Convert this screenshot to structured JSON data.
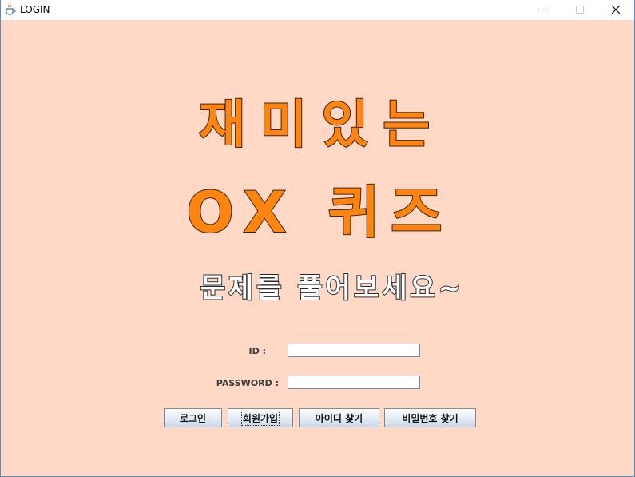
{
  "window": {
    "title": "LOGIN",
    "icons": {
      "app": "java-coffee-cup-icon",
      "minimize": "minimize-icon",
      "maximize": "maximize-icon",
      "close": "close-icon"
    }
  },
  "colors": {
    "background": "#ffd9c6",
    "headline_fill": "#ff8410",
    "headline_outline": "#3e2110",
    "subtitle_fill": "#ffffff"
  },
  "header": {
    "line1": "재미있는",
    "line2": "OX 퀴즈",
    "subtitle": "문제를 풀어보세요~"
  },
  "form": {
    "id_label": "ID :",
    "id_value": "",
    "password_label": "PASSWORD :",
    "password_value": ""
  },
  "buttons": {
    "login": "로그인",
    "signup": "회원가입",
    "find_id": "아이디 찾기",
    "find_password": "비밀번호 찾기"
  }
}
